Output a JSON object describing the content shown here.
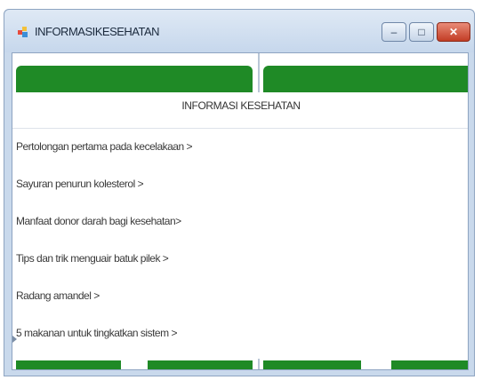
{
  "window": {
    "title": "INFORMASIKESEHATAN",
    "icon": "app-icon",
    "controls": {
      "minimize": "–",
      "maximize": "□",
      "close": "✕"
    }
  },
  "panel": {
    "header": "INFORMASI KESEHATAN",
    "items": [
      {
        "label": "Pertolongan pertama pada kecelakaan >"
      },
      {
        "label": "Sayuran penurun kolesterol >"
      },
      {
        "label": "Manfaat donor darah bagi kesehatan>"
      },
      {
        "label": "Tips dan trik menguair batuk pilek >"
      },
      {
        "label": "Radang amandel >"
      },
      {
        "label": "5 makanan untuk tingkatkan sistem >"
      }
    ]
  },
  "colors": {
    "tile_green": "#1f8a26",
    "titlebar": "#c6d7ec",
    "close_button": "#c23d25"
  }
}
